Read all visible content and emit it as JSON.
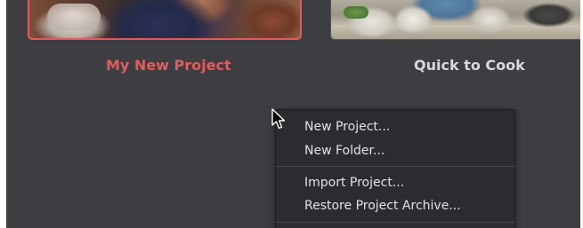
{
  "projects": [
    {
      "title": "My New Project",
      "selected": true
    },
    {
      "title": "Quick to Cook",
      "selected": false
    }
  ],
  "context_menu": {
    "items": [
      {
        "label": "New Project..."
      },
      {
        "label": "New Folder..."
      },
      {
        "label": "Import Project..."
      },
      {
        "label": "Restore Project Archive..."
      }
    ]
  },
  "colors": {
    "background": "#3d3d42",
    "selected_accent": "#e15c5e",
    "menu_background": "#2b2b30",
    "menu_text": "#e2e2e4",
    "title_text": "#d9d9dc"
  },
  "icons": {
    "cursor": "arrow-cursor-icon"
  }
}
